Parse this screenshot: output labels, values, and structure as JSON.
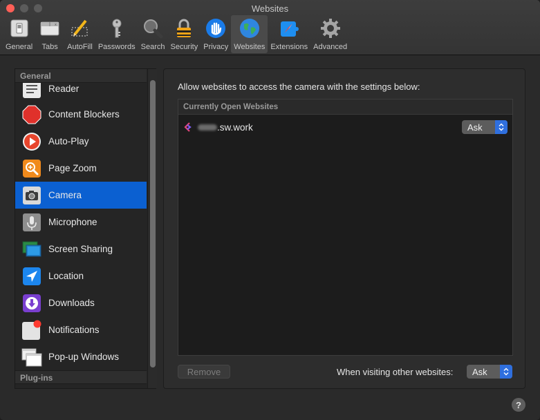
{
  "window": {
    "title": "Websites"
  },
  "toolbar": {
    "items": [
      {
        "label": "General",
        "icon": "general-switch-icon"
      },
      {
        "label": "Tabs",
        "icon": "tabs-icon"
      },
      {
        "label": "AutoFill",
        "icon": "autofill-pencil-icon"
      },
      {
        "label": "Passwords",
        "icon": "key-icon"
      },
      {
        "label": "Search",
        "icon": "magnifier-icon"
      },
      {
        "label": "Security",
        "icon": "padlock-icon"
      },
      {
        "label": "Privacy",
        "icon": "hand-icon"
      },
      {
        "label": "Websites",
        "icon": "globe-icon",
        "selected": true
      },
      {
        "label": "Extensions",
        "icon": "puzzle-compass-icon"
      },
      {
        "label": "Advanced",
        "icon": "gear-icon"
      }
    ]
  },
  "sidebar": {
    "general_header": "General",
    "plugins_header": "Plug-ins",
    "items": [
      {
        "label": "Reader",
        "icon": "reader-icon"
      },
      {
        "label": "Content Blockers",
        "icon": "stop-sign-icon"
      },
      {
        "label": "Auto-Play",
        "icon": "play-icon"
      },
      {
        "label": "Page Zoom",
        "icon": "zoom-icon"
      },
      {
        "label": "Camera",
        "icon": "camera-icon",
        "selected": true
      },
      {
        "label": "Microphone",
        "icon": "microphone-icon"
      },
      {
        "label": "Screen Sharing",
        "icon": "screen-sharing-icon"
      },
      {
        "label": "Location",
        "icon": "location-arrow-icon"
      },
      {
        "label": "Downloads",
        "icon": "download-icon"
      },
      {
        "label": "Notifications",
        "icon": "notification-icon"
      },
      {
        "label": "Pop-up Windows",
        "icon": "popup-windows-icon"
      }
    ]
  },
  "main": {
    "description": "Allow websites to access the camera with the settings below:",
    "table_header": "Currently Open Websites",
    "rows": [
      {
        "site": ".sw.work",
        "setting": "Ask"
      }
    ],
    "remove_button": "Remove",
    "other_label": "When visiting other websites:",
    "other_setting": "Ask"
  },
  "help": "?",
  "colors": {
    "selection": "#0b60d1",
    "popup_accent": "#2f6fde",
    "close_button": "#ff5f57"
  }
}
